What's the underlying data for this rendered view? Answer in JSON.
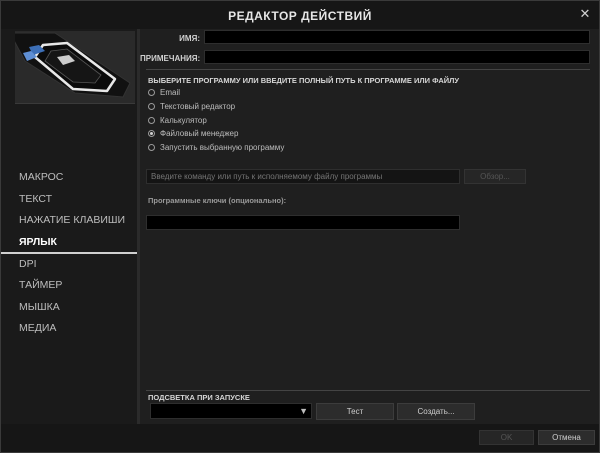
{
  "window": {
    "title": "РЕДАКТОР ДЕЙСТВИЙ",
    "close_icon": "close-icon"
  },
  "nav": {
    "items": [
      {
        "label": "МАКРОС",
        "active": false
      },
      {
        "label": "ТЕКСТ",
        "active": false
      },
      {
        "label": "НАЖАТИЕ КЛАВИШИ",
        "active": false
      },
      {
        "label": "ЯРЛЫК",
        "active": true
      },
      {
        "label": "DPI",
        "active": false
      },
      {
        "label": "ТАЙМЕР",
        "active": false
      },
      {
        "label": "МЫШКА",
        "active": false
      },
      {
        "label": "МЕДИА",
        "active": false
      }
    ]
  },
  "form": {
    "name_label": "ИМЯ:",
    "name_value": "",
    "notes_label": "ПРИМЕЧАНИЯ:",
    "notes_value": ""
  },
  "program": {
    "section_title": "ВЫБЕРИТЕ ПРОГРАММУ ИЛИ ВВЕДИТЕ ПОЛНЫЙ ПУТЬ К ПРОГРАММЕ ИЛИ ФАЙЛУ",
    "options": [
      {
        "label": "Email",
        "checked": false
      },
      {
        "label": "Текстовый редактор",
        "checked": false
      },
      {
        "label": "Калькулятор",
        "checked": false
      },
      {
        "label": "Файловый менеджер",
        "checked": true
      },
      {
        "label": "Запустить выбранную программу",
        "checked": false
      }
    ],
    "path_placeholder": "Введите команду или путь к исполняемому файлу программы",
    "browse_label": "Обзор...",
    "keys_label": "Программные ключи (опционально):",
    "keys_value": ""
  },
  "lighting": {
    "title": "ПОДСВЕТКА ПРИ ЗАПУСКЕ",
    "selected": "",
    "test_label": "Тест",
    "create_label": "Создать..."
  },
  "footer": {
    "ok_label": "OK",
    "cancel_label": "Отмена"
  }
}
